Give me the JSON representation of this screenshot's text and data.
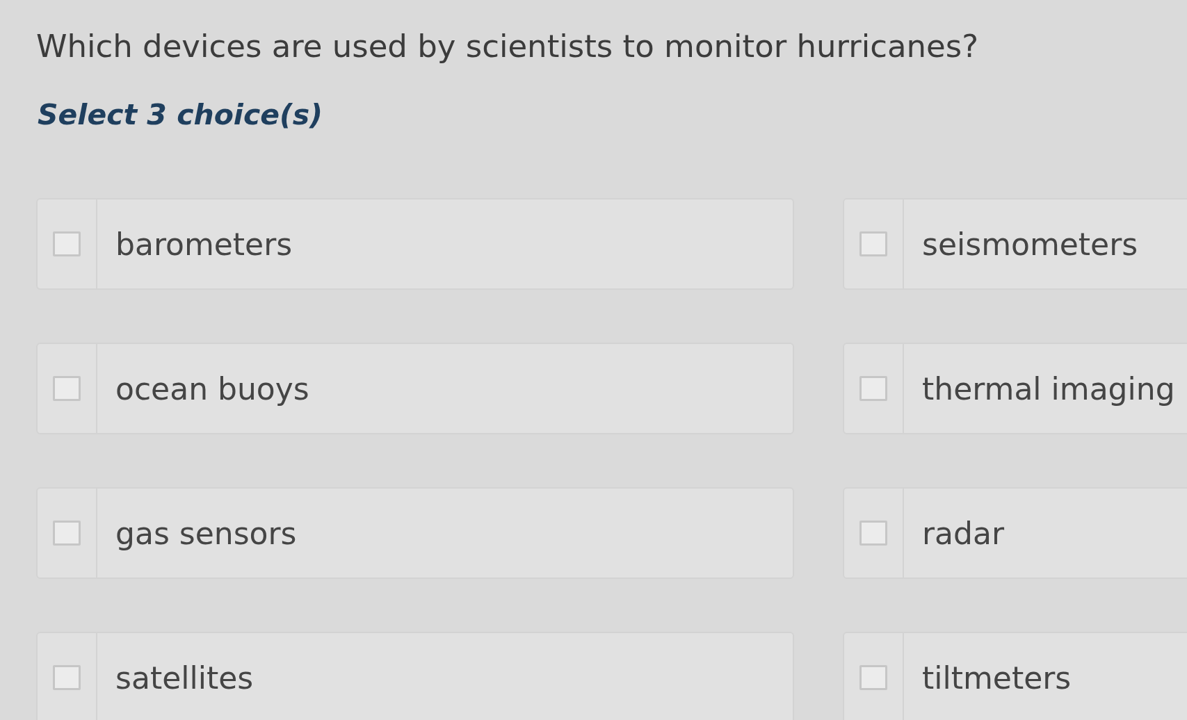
{
  "question": "Which devices are used by scientists to monitor hurricanes?",
  "instruction": "Select 3 choice(s)",
  "choices": [
    {
      "label": "barometers",
      "checked": false
    },
    {
      "label": "seismometers",
      "checked": false
    },
    {
      "label": "ocean buoys",
      "checked": false
    },
    {
      "label": "thermal imaging",
      "checked": false
    },
    {
      "label": "gas sensors",
      "checked": false
    },
    {
      "label": "radar",
      "checked": false
    },
    {
      "label": "satellites",
      "checked": false
    },
    {
      "label": "tiltmeters",
      "checked": false
    }
  ]
}
